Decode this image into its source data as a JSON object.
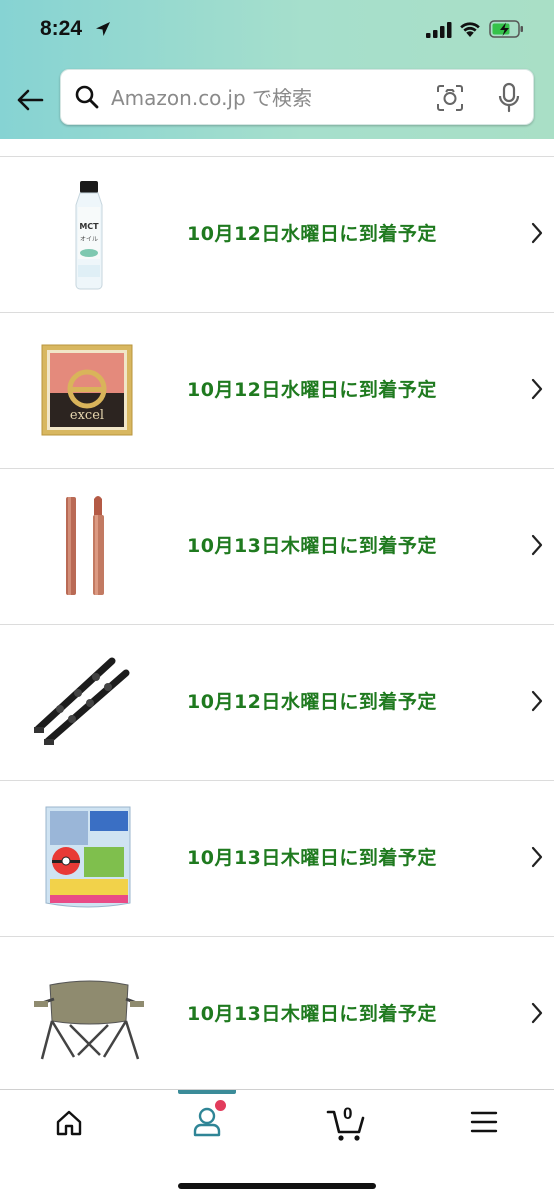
{
  "status_bar": {
    "time": "8:24"
  },
  "search": {
    "placeholder": "Amazon.co.jp で検索"
  },
  "orders": [
    {
      "product_image": "mct-oil-bottle",
      "delivery": "10月12日水曜日に到着予定"
    },
    {
      "product_image": "excel-blush-compact",
      "delivery": "10月12日水曜日に到着予定"
    },
    {
      "product_image": "lipstick",
      "delivery": "10月13日木曜日に到着予定"
    },
    {
      "product_image": "black-straps",
      "delivery": "10月12日水曜日に到着予定"
    },
    {
      "product_image": "pokemon-bath-ball",
      "delivery": "10月13日木曜日に到着予定"
    },
    {
      "product_image": "camping-chair",
      "delivery": "10月13日木曜日に到着予定"
    }
  ],
  "bottom_nav": {
    "cart_count": "0"
  },
  "colors": {
    "delivery_text": "#1f7a1f",
    "header_start": "#86d3d3",
    "header_end": "#a9dfc6",
    "notification_dot": "#e23c5c"
  }
}
